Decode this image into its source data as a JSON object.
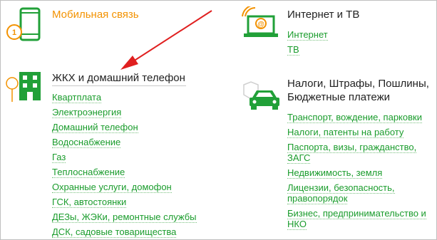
{
  "colors": {
    "link": "#1a9c2c",
    "heading": "#222222",
    "accent_orange": "#f39200",
    "icon_green": "#21a038",
    "arrow_red": "#e02020"
  },
  "categories": {
    "mobile": {
      "title": "Мобильная связь",
      "icon": "smartphone-icon",
      "badge": "1"
    },
    "internet": {
      "title": "Интернет и ТВ",
      "icon": "laptop-icon",
      "links": [
        "Интернет",
        "ТВ"
      ]
    },
    "utilities": {
      "title": "ЖКХ и домашний телефон",
      "icon": "building-icon",
      "links": [
        "Квартплата",
        "Электроэнергия",
        "Домашний телефон",
        "Водоснабжение",
        "Газ",
        "Теплоснабжение",
        "Охранные услуги, домофон",
        "ГСК, автостоянки",
        "ДЕЗы, ЖЭКи, ремонтные службы",
        "ДСК, садовые товарищества"
      ]
    },
    "taxes": {
      "title_line1": "Налоги, Штрафы, Пошлины,",
      "title_line2": "Бюджетные платежи",
      "icon": "car-icon",
      "links": [
        [
          "Транспорт, вождение, парковки"
        ],
        [
          "Налоги, патенты на работу"
        ],
        [
          "Паспорта, визы, гражданство,",
          "ЗАГС"
        ],
        [
          "Недвижимость, земля"
        ],
        [
          "Лицензии, безопасность,",
          "правопорядок"
        ],
        [
          "Бизнес, предпринимательство и",
          "НКО"
        ]
      ]
    }
  }
}
